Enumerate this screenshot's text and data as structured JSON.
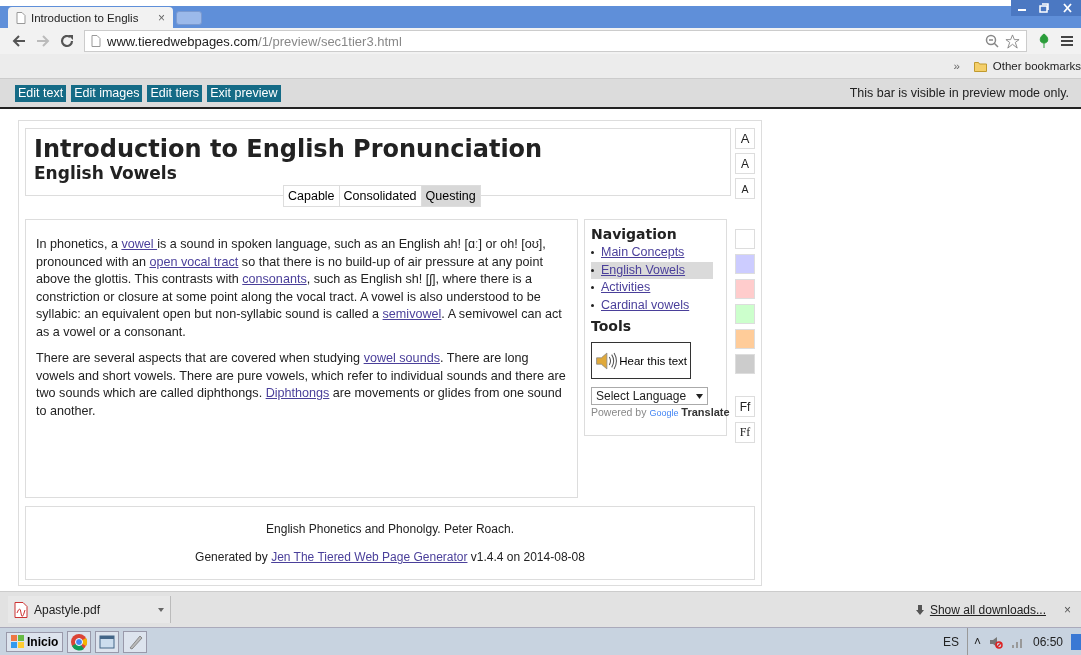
{
  "browser": {
    "tabs": [
      {
        "title": "Introduction to Englis",
        "close": "×",
        "selected": true
      }
    ],
    "url_host": "www.tieredwebpages.com",
    "url_path": "/1/preview/sec1tier3.html",
    "bookmarks_more": "»",
    "bookmarks_folder": "Other bookmarks"
  },
  "preview_bar": {
    "buttons": [
      "Edit text",
      "Edit images",
      "Edit tiers",
      "Exit preview"
    ],
    "note": "This bar is visible in preview mode only."
  },
  "page": {
    "title": "Introduction to English Pronunciation",
    "subtitle": "English Vowels",
    "tiers": [
      {
        "label": "Capable",
        "selected": false
      },
      {
        "label": "Consolidated",
        "selected": false
      },
      {
        "label": "Questing",
        "selected": true
      }
    ],
    "size_buttons": [
      {
        "label": "A",
        "kind": "large"
      },
      {
        "label": "A",
        "kind": "medium"
      },
      {
        "label": "A",
        "kind": "small"
      }
    ],
    "paragraphs": [
      [
        {
          "text": "In phonetics, a ",
          "link": false
        },
        {
          "text": "vowel ",
          "link": true
        },
        {
          "text": "is a sound in spoken language, such as an English ah! [ɑː] or oh! [oʊ], pronounced with an ",
          "link": false
        },
        {
          "text": "open vocal tract",
          "link": true
        },
        {
          "text": " so that there is no build-up of air pressure at any point above the glottis. This contrasts with ",
          "link": false
        },
        {
          "text": "consonants",
          "link": true
        },
        {
          "text": ", such as English sh! [ʃ], where there is a constriction or closure at some point along the vocal tract. A vowel is also understood to be syllabic: an equivalent open but non-syllabic sound is called a ",
          "link": false
        },
        {
          "text": "semivowel",
          "link": true
        },
        {
          "text": ". A semivowel can act as a vowel or a consonant.",
          "link": false
        }
      ],
      [
        {
          "text": "There are several aspects that are covered when studying ",
          "link": false
        },
        {
          "text": "vowel sounds",
          "link": true
        },
        {
          "text": ". There are long vowels and short vowels. There are pure vowels, which refer to individual sounds and there are two sounds which are called diphthongs. ",
          "link": false
        },
        {
          "text": "Diphthongs",
          "link": true
        },
        {
          "text": " are movements or glides from one sound to another.",
          "link": false
        }
      ]
    ],
    "navigation": {
      "heading": "Navigation",
      "items": [
        {
          "label": "Main Concepts",
          "selected": false
        },
        {
          "label": "English Vowels",
          "selected": true
        },
        {
          "label": "Activities",
          "selected": false
        },
        {
          "label": "Cardinal vowels",
          "selected": false
        }
      ]
    },
    "tools": {
      "heading": "Tools",
      "hear_button": "Hear this text",
      "language_select": "Select Language",
      "powered_by": "Powered by",
      "google": "Google",
      "translate": "Translate"
    },
    "swatches": [
      {
        "color": "#ffffff"
      },
      {
        "color": "#ccccff"
      },
      {
        "color": "#ffcccc"
      },
      {
        "color": "#ccffcc"
      },
      {
        "color": "#ffcc99"
      },
      {
        "color": "#cccccc"
      }
    ],
    "font_buttons": [
      {
        "label": "Ff",
        "kind": "sans"
      },
      {
        "label": "Ff",
        "kind": "serif"
      }
    ],
    "footer": {
      "reference": "English Phonetics and Phonolgy. Peter Roach.",
      "generated_prefix": "Generated by ",
      "generator_link": "Jen The Tiered Web Page Generator",
      "generated_suffix": " v1.4.4 on 2014-08-08"
    }
  },
  "downloads": {
    "file": "Apastyle.pdf",
    "show_all": "Show all downloads...",
    "close": "×"
  },
  "taskbar": {
    "start": "Inicio",
    "language": "ES",
    "tray_arrow": "˄",
    "time": "06:50"
  }
}
